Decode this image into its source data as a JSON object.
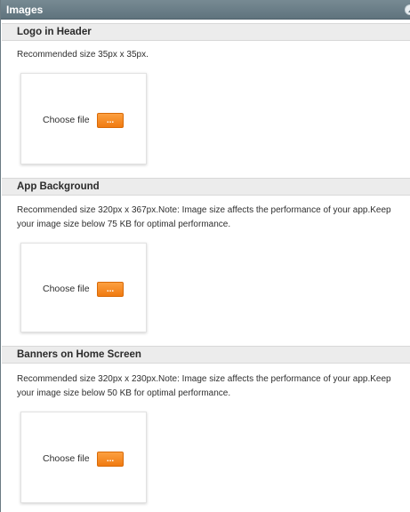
{
  "panel": {
    "title": "Images",
    "collapse_icon": "collapse-up-icon"
  },
  "sections": [
    {
      "title": "Logo in Header",
      "description": "Recommended size 35px x 35px.",
      "choose_label": "Choose file",
      "browse_label": "..."
    },
    {
      "title": "App Background",
      "description": "Recommended size 320px x 367px.Note: Image size affects the performance of your app.Keep your image size below 75 KB for optimal performance.",
      "choose_label": "Choose file",
      "browse_label": "..."
    },
    {
      "title": "Banners on Home Screen",
      "description": "Recommended size 320px x 230px.Note: Image size affects the performance of your app.Keep your image size below 50 KB for optimal performance.",
      "choose_label": "Choose file",
      "browse_label": "..."
    }
  ],
  "colors": {
    "header_bg": "#6b7f89",
    "section_bg": "#ececec",
    "button_accent": "#f28a20"
  }
}
